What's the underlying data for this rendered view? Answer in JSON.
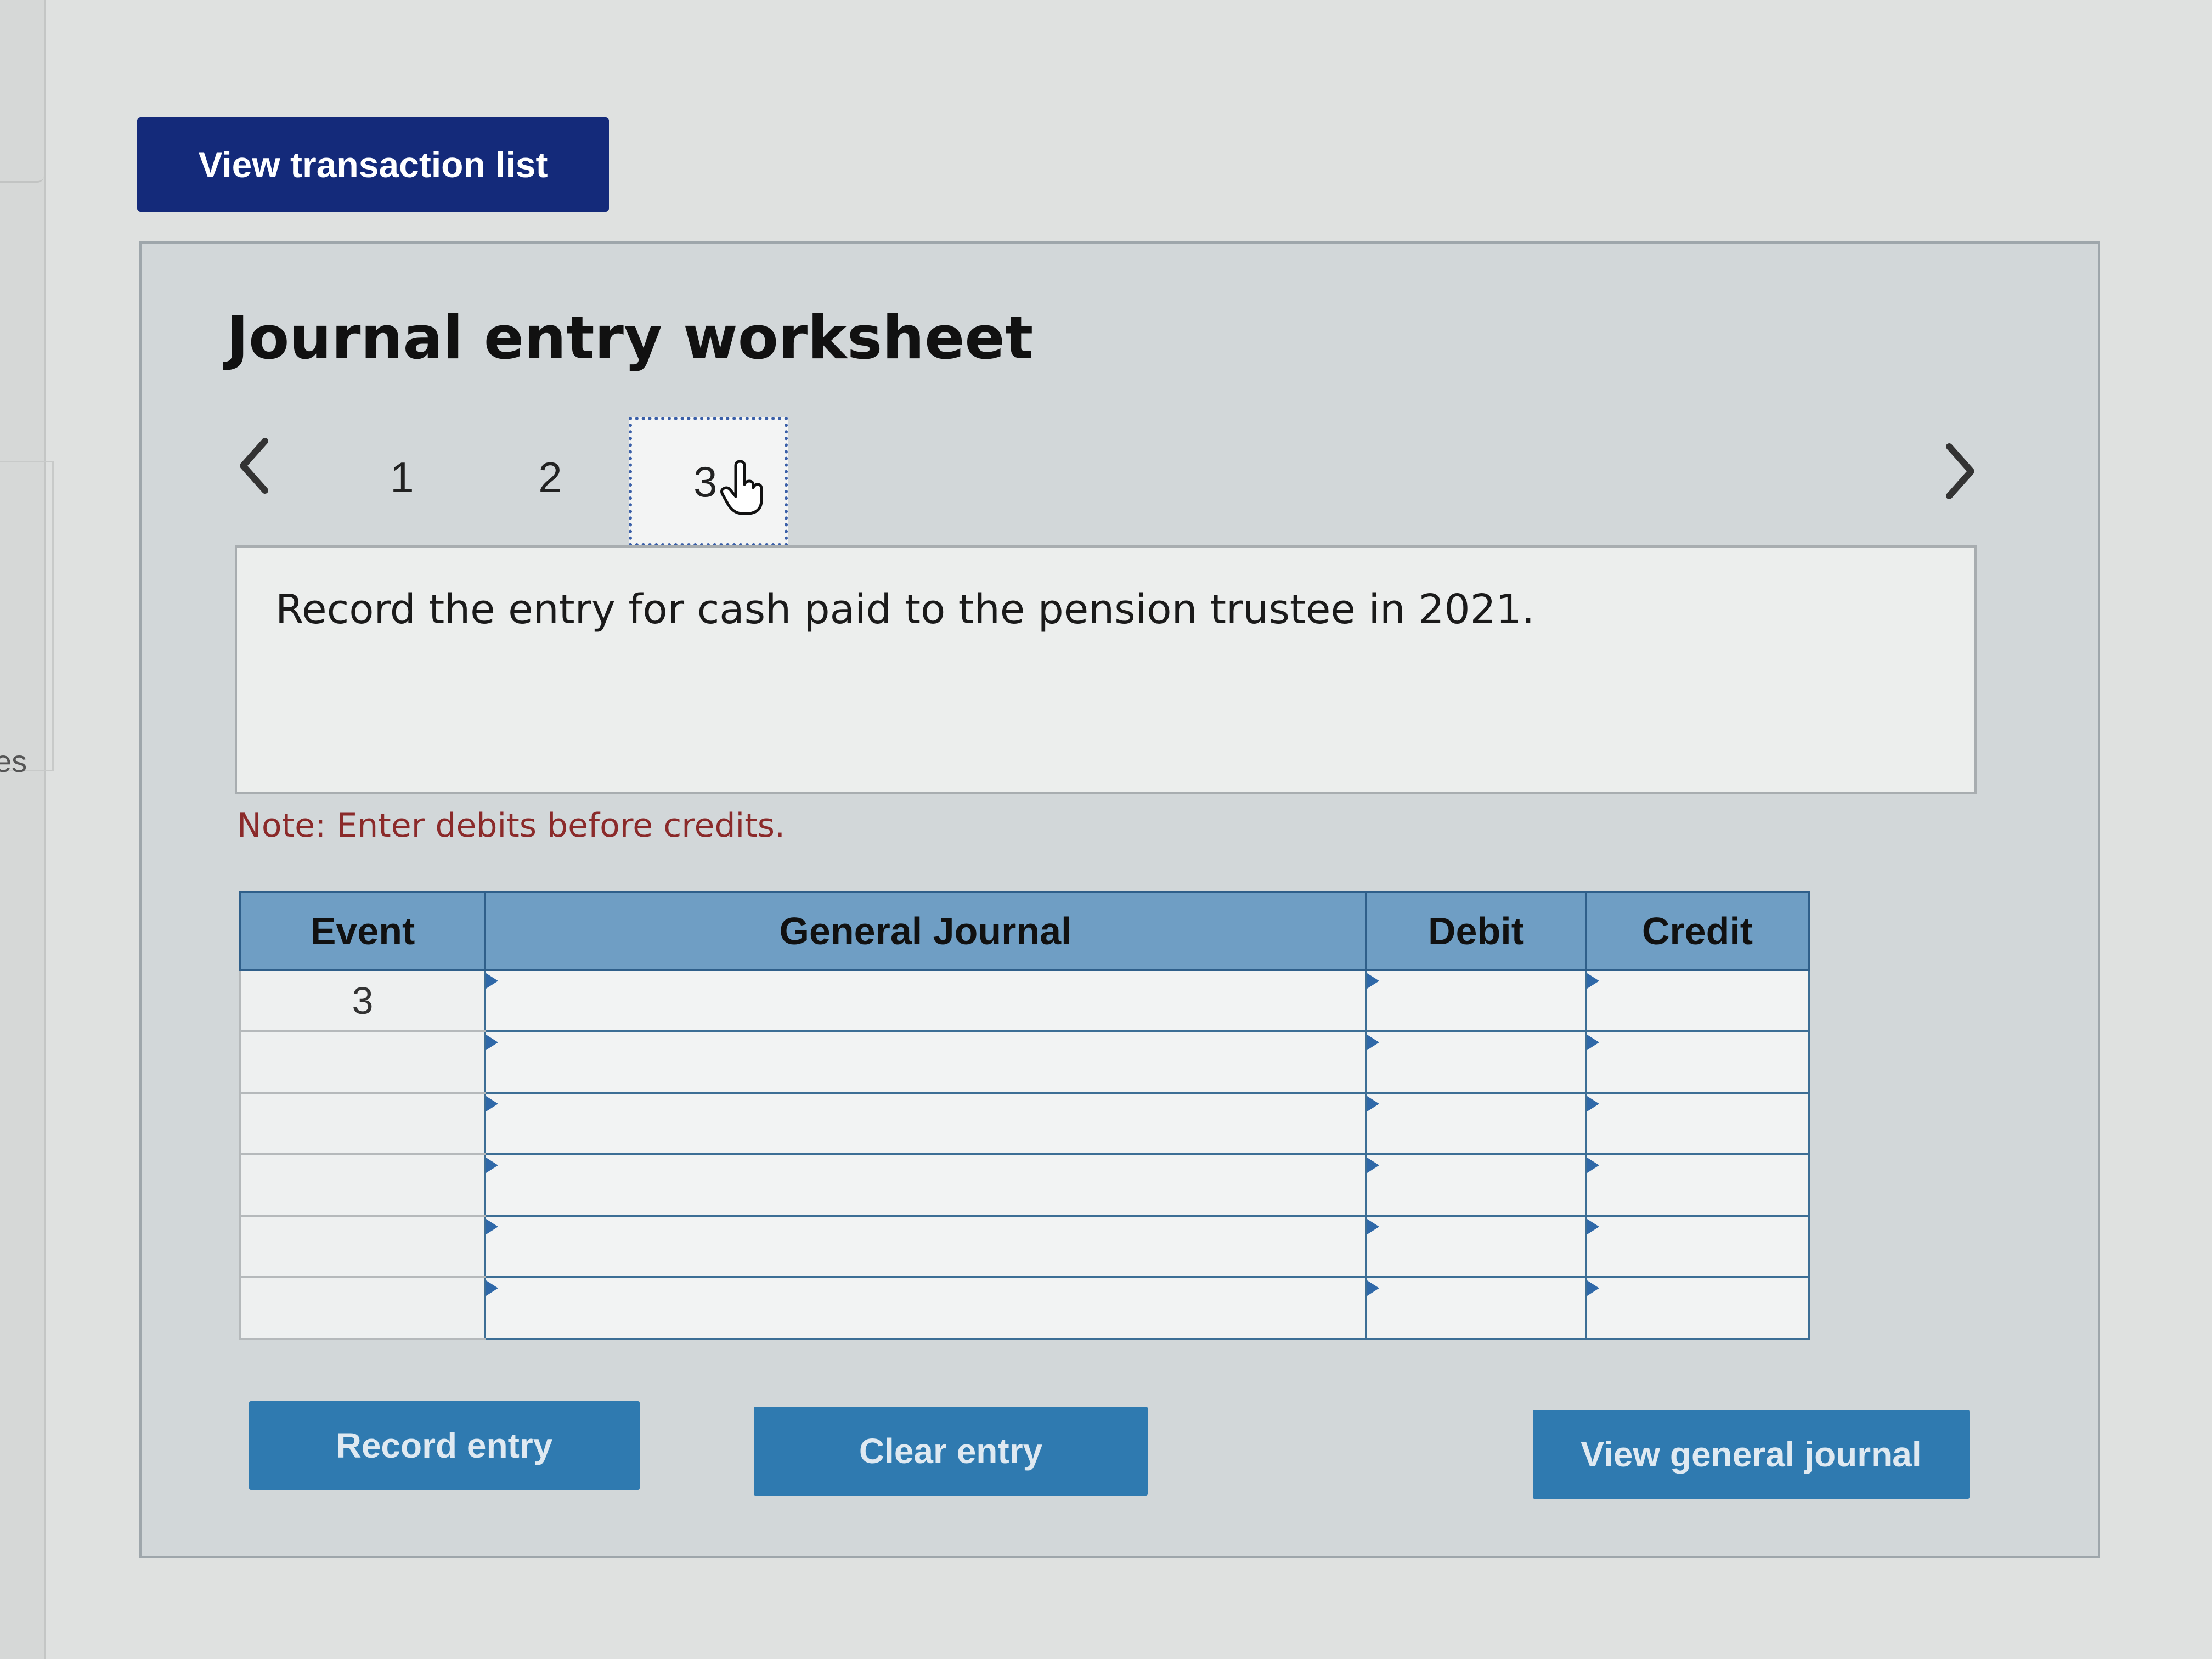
{
  "left_edge": {
    "partial_text": "es"
  },
  "top": {
    "view_transaction_list_label": "View transaction list"
  },
  "worksheet": {
    "title": "Journal entry worksheet",
    "pages": [
      "1",
      "2",
      "3"
    ],
    "active_page": "3",
    "prompt": "Record the entry for cash paid to the pension trustee in 2021.",
    "note": "Note: Enter debits before credits."
  },
  "table": {
    "headers": {
      "event": "Event",
      "general_journal": "General Journal",
      "debit": "Debit",
      "credit": "Credit"
    },
    "rows": [
      {
        "event": "3",
        "general_journal": "",
        "debit": "",
        "credit": ""
      },
      {
        "event": "",
        "general_journal": "",
        "debit": "",
        "credit": ""
      },
      {
        "event": "",
        "general_journal": "",
        "debit": "",
        "credit": ""
      },
      {
        "event": "",
        "general_journal": "",
        "debit": "",
        "credit": ""
      },
      {
        "event": "",
        "general_journal": "",
        "debit": "",
        "credit": ""
      },
      {
        "event": "",
        "general_journal": "",
        "debit": "",
        "credit": ""
      }
    ]
  },
  "buttons": {
    "record_entry": "Record entry",
    "clear_entry": "Clear entry",
    "view_general_journal": "View general journal"
  },
  "icons": {
    "prev": "chevron-left-icon",
    "next": "chevron-right-icon",
    "cursor": "hand-pointer-icon"
  },
  "colors": {
    "top_button_bg": "#142a7a",
    "action_button_bg": "#2f7ab0",
    "table_header_bg": "#6f9ec4",
    "note_text": "#8b2a2a"
  }
}
